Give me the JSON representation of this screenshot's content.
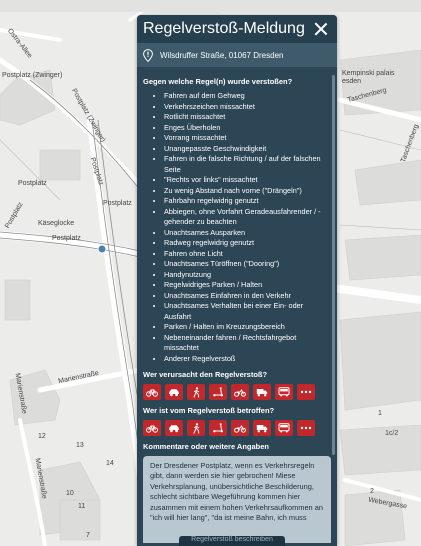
{
  "panel": {
    "title": "Regelverstoß-Meldung",
    "address": "Wilsdruffer Straße, 01067 Dresden",
    "rules_heading": "Gegen welche Regel(n) wurde verstoßen?",
    "rules": [
      "Fahren auf dem Gehweg",
      "Verkehrszeichen missachtet",
      "Rotlicht missachtet",
      "Enges Überholen",
      "Vorrang missachtet",
      "Unangepasste Geschwindigkeit",
      "Fahren in die falsche Richtung / auf der falschen Seite",
      "\"Rechts vor links\" missachtet",
      "Zu wenig Abstand nach vorne (\"Drängeln\")",
      "Fahrbahn regelwidrig genutzt",
      "Abbiegen, ohne Vorfahrt Geradeausfahrender / -gehender zu beachten",
      "Unachtsames Ausparken",
      "Radweg regelwidrig genutzt",
      "Fahren ohne Licht",
      "Unachtsames Türöffnen (\"Dooring\")",
      "Handynutzung",
      "Regelwidriges Parken / Halten",
      "Unachtsames Einfahren in den Verkehr",
      "Unachtsames Verhalten bei einer Ein- oder Ausfahrt",
      "Parken / Halten im Kreuzungsbereich",
      "Nebeneinander fahren / Rechtsfahrgebot missachtet",
      "Anderer Regelverstoß"
    ],
    "cause_heading": "Wer verursacht den Regelverstoß?",
    "affected_heading": "Wer ist vom Regelverstoß betroffen?",
    "vehicle_icons": [
      "bicycle-icon",
      "car-icon",
      "pedestrian-icon",
      "kick-scooter-icon",
      "motorcycle-icon",
      "truck-icon",
      "bus-icon",
      "more-icon"
    ],
    "comments_heading": "Kommentare oder weitere Angaben",
    "comment_text": "Der Dresdener Postplatz, wenn es Verkehrsregeln gibt, dann werden sie hier gebrochen! Miese Verkehrsplanung, unübersichtliche Beschilderung, schlecht sichtbare Wegeführung kommen hier zusammen mit einem hohen Verkehrsaufkommen an \"ich will hier lang\", \"da ist meine Bahn, ich muss",
    "submit_label": "Regelverstoß beschreiben"
  },
  "map": {
    "labels": {
      "ostra": "Ostra-Allee",
      "zwinger": "Postplatz (Zwinger)",
      "zwinger2": "Postplatz (Zwinger)",
      "postplatz1": "Postplatz",
      "postplatz2": "Postplatz",
      "postplatz3": "Postplatz",
      "postplatz4": "Postplatz",
      "postplatz5": "Postplatz",
      "kaesegl": "Käseglocke",
      "marien1": "Marienstraße",
      "marien2": "Marienstraße",
      "marien3": "Marienstraße",
      "taschenberg": "Taschenberg",
      "taschenberg2": "Taschenberg",
      "palais": "Kempinski palais esden",
      "weber": "Webergasse",
      "n12": "12",
      "n13": "13",
      "n14": "14",
      "n10": "10",
      "n11": "11",
      "n7": "7",
      "n1": "1",
      "n2": "2",
      "n1c2": "1c/2"
    }
  }
}
